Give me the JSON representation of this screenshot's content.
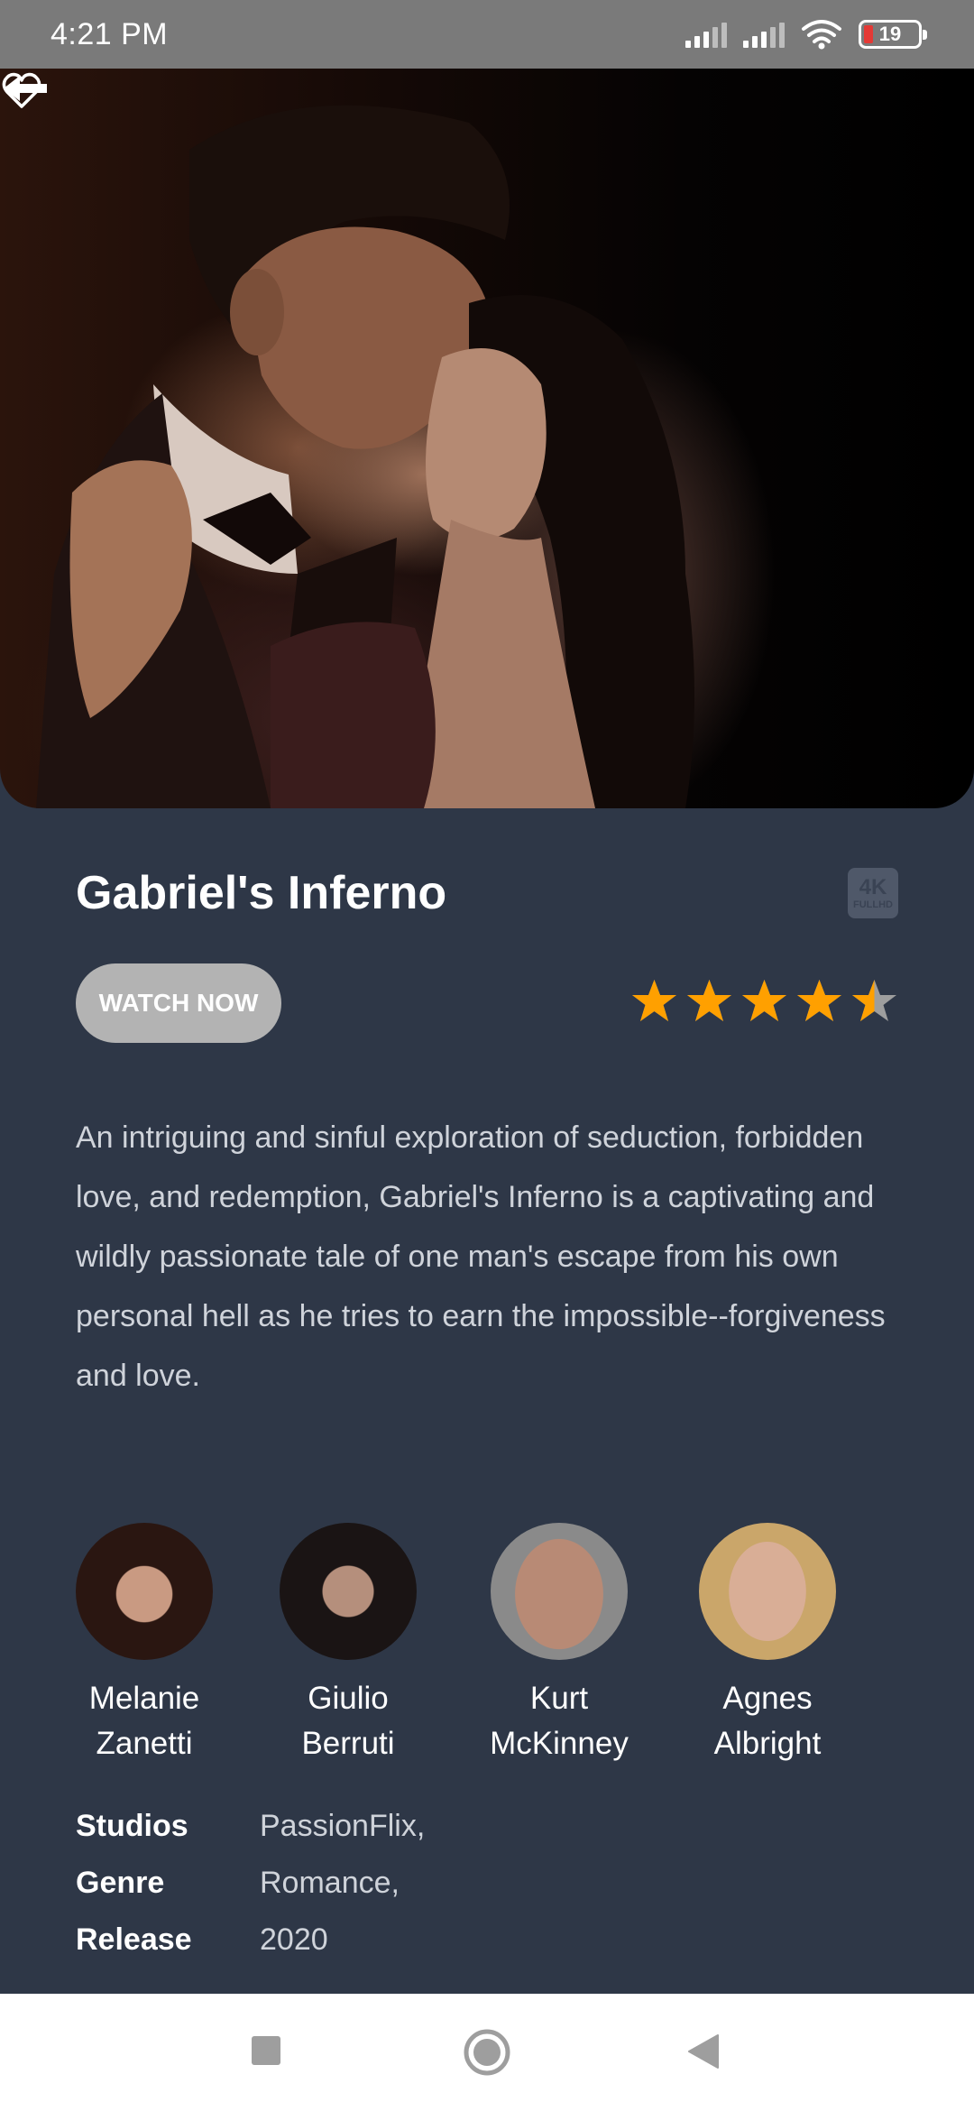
{
  "status_bar": {
    "time": "4:21 PM",
    "battery_level": "19",
    "icons": [
      "signal-icon",
      "signal-icon",
      "wifi-icon",
      "battery-icon"
    ]
  },
  "header": {
    "back_icon": "back-arrow-icon",
    "favorite_icon": "heart-outline-icon"
  },
  "movie": {
    "title": "Gabriel's Inferno",
    "quality_badge": {
      "top": "4K",
      "bottom": "FULLHD"
    },
    "watch_button": "WATCH NOW",
    "rating": {
      "value": 4.5,
      "max": 5
    },
    "description": "An intriguing and sinful exploration of seduction, forbidden love, and redemption, Gabriel's Inferno is a captivating and wildly passionate tale of one man's escape from his own personal hell as he tries to earn the impossible--forgiveness and love."
  },
  "cast": [
    {
      "first": "Melanie",
      "last": "Zanetti"
    },
    {
      "first": "Giulio",
      "last": "Berruti"
    },
    {
      "first": "Kurt",
      "last": "McKinney"
    },
    {
      "first": "Agnes",
      "last": "Albright"
    }
  ],
  "info": [
    {
      "label": "Studios",
      "value": "PassionFlix,"
    },
    {
      "label": "Genre",
      "value": "Romance,"
    },
    {
      "label": "Release",
      "value": "2020"
    }
  ],
  "nav": {
    "icons": [
      "recent-apps-icon",
      "home-icon",
      "back-icon"
    ]
  },
  "colors": {
    "background": "#2e3747",
    "star": "#ffa000",
    "star_empty": "#9e9e9e",
    "button": "#b3b3b3"
  }
}
